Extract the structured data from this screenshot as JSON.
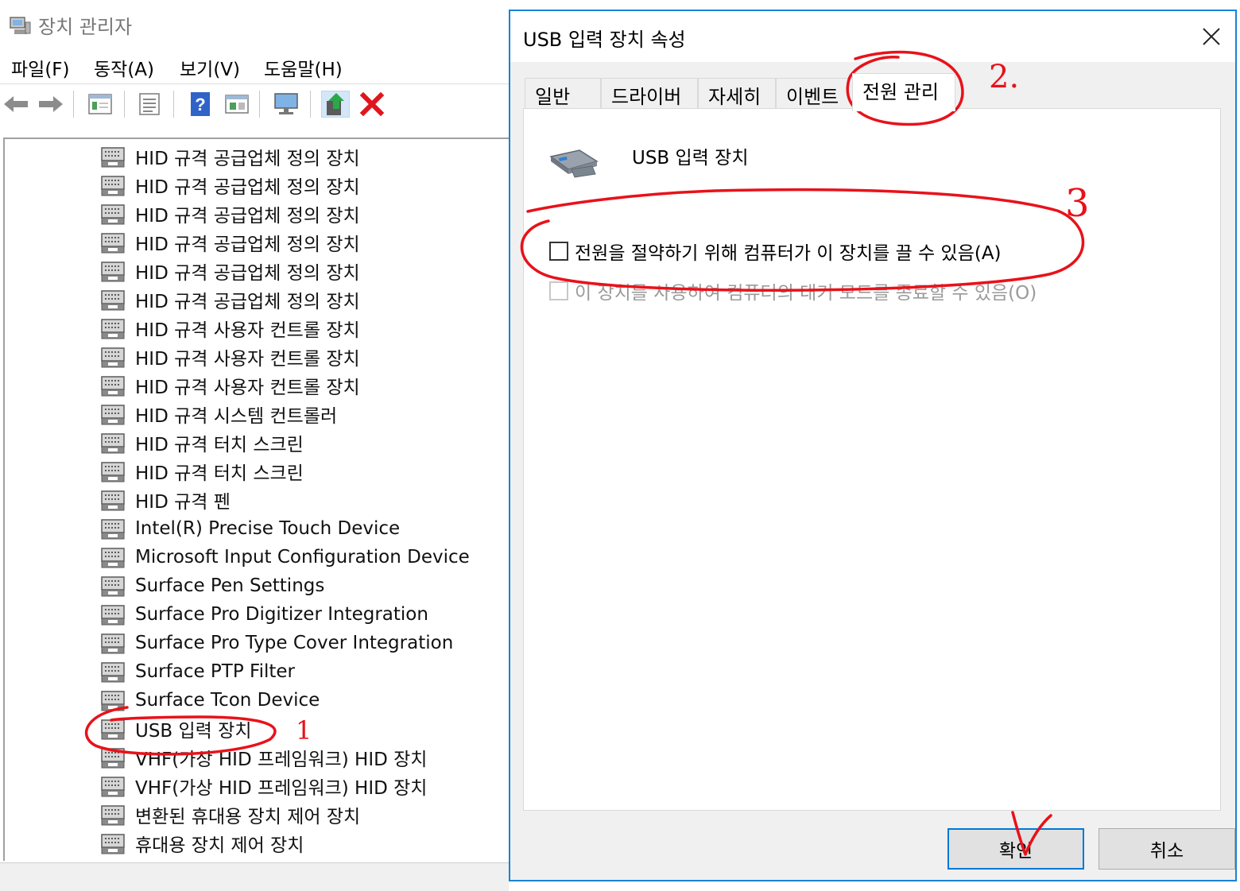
{
  "device_manager": {
    "title": "장치 관리자",
    "menus": [
      "파일(F)",
      "동작(A)",
      "보기(V)",
      "도움말(H)"
    ],
    "toolbar_icons": [
      "back-arrow-icon",
      "forward-arrow-icon",
      "properties-icon",
      "view-icon",
      "help-icon",
      "update-driver-icon",
      "monitor-icon",
      "enable-device-icon",
      "uninstall-x-icon"
    ],
    "tree_items": [
      "HID 규격 공급업체 정의 장치",
      "HID 규격 공급업체 정의 장치",
      "HID 규격 공급업체 정의 장치",
      "HID 규격 공급업체 정의 장치",
      "HID 규격 공급업체 정의 장치",
      "HID 규격 공급업체 정의 장치",
      "HID 규격 사용자 컨트롤 장치",
      "HID 규격 사용자 컨트롤 장치",
      "HID 규격 사용자 컨트롤 장치",
      "HID 규격 시스템 컨트롤러",
      "HID 규격 터치 스크린",
      "HID 규격 터치 스크린",
      "HID 규격 펜",
      "Intel(R) Precise Touch Device",
      "Microsoft Input Configuration Device",
      "Surface Pen Settings",
      "Surface Pro Digitizer Integration",
      "Surface Pro Type Cover Integration",
      "Surface PTP Filter",
      "Surface Tcon Device",
      "USB 입력 장치",
      "VHF(가상 HID 프레임워크) HID 장치",
      "VHF(가상 HID 프레임워크) HID 장치",
      "변환된 휴대용 장치 제어 장치",
      "휴대용 장치 제어 장치"
    ]
  },
  "dialog": {
    "title": "USB 입력 장치 속성",
    "tabs": [
      "일반",
      "드라이버",
      "자세히",
      "이벤트",
      "전원 관리"
    ],
    "active_tab": "전원 관리",
    "device_name": "USB 입력 장치",
    "options": [
      {
        "label": "전원을 절약하기 위해 컴퓨터가 이 장치를 끌 수 있음(A)",
        "checked": false,
        "enabled": true
      },
      {
        "label": "이 장치를 사용하여 컴퓨터의 대기 모드를 종료할 수 있음(O)",
        "checked": false,
        "enabled": false
      }
    ],
    "ok_label": "확인",
    "cancel_label": "취소",
    "accent": "#1883d7"
  },
  "annotations": {
    "color": "#e8121a",
    "marks": [
      "1",
      "2.",
      "3"
    ]
  }
}
